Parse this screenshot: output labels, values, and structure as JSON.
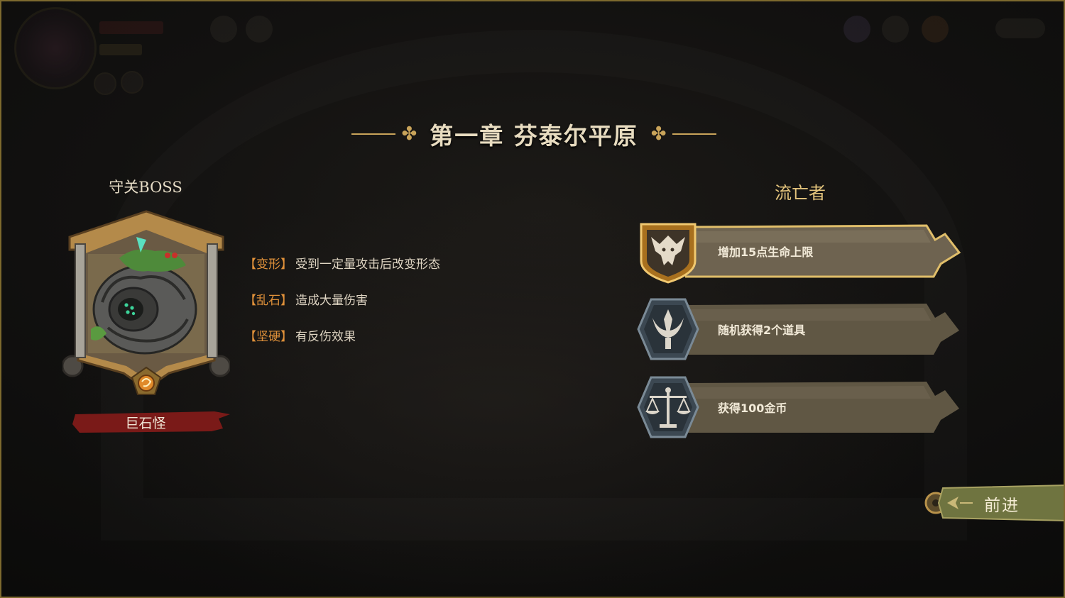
{
  "chapter": {
    "title": "第一章 芬泰尔平原"
  },
  "boss": {
    "heading": "守关BOSS",
    "name": "巨石怪",
    "abilities": [
      {
        "tag": "【变形】",
        "description": "受到一定量攻击后改变形态"
      },
      {
        "tag": "【乱石】",
        "description": "造成大量伤害"
      },
      {
        "tag": "【坚硬】",
        "description": "有反伤效果"
      }
    ]
  },
  "exile": {
    "heading": "流亡者",
    "rewards": [
      {
        "label": "增加15点生命上限",
        "icon": "horned-beast-emblem-icon",
        "selected": true
      },
      {
        "label": "随机获得2个道具",
        "icon": "trident-crest-emblem-icon",
        "selected": false
      },
      {
        "label": "获得100金币",
        "icon": "scales-emblem-icon",
        "selected": false
      }
    ]
  },
  "actions": {
    "forward_label": "前进"
  },
  "colors": {
    "accent_gold": "#c9a45a",
    "ability_tag": "#e0913a",
    "boss_banner": "#7a1a18",
    "forward_button": "#6f7440"
  }
}
